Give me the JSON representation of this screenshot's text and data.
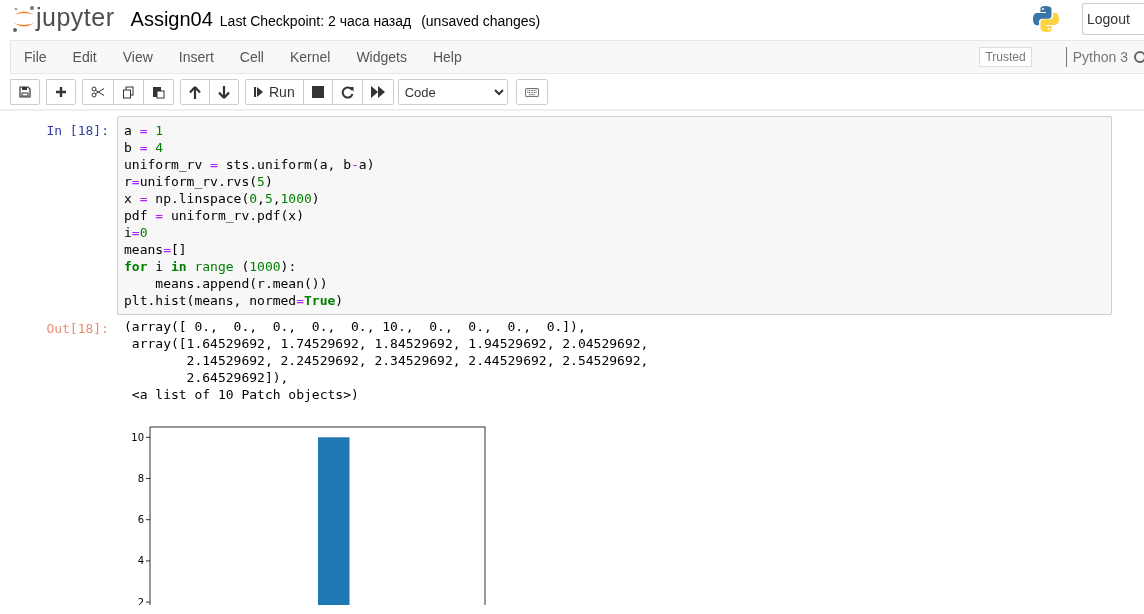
{
  "header": {
    "logo_text": "jupyter",
    "notebook_name": "Assign04",
    "checkpoint": "Last Checkpoint: 2 часа назад",
    "unsaved": "(unsaved changes)",
    "logout": "Logout"
  },
  "menu": [
    "File",
    "Edit",
    "View",
    "Insert",
    "Cell",
    "Kernel",
    "Widgets",
    "Help"
  ],
  "trusted": "Trusted",
  "kernel": "Python 3",
  "kernel_busy": false,
  "toolbar": {
    "groups": [
      [
        {
          "kind": "save"
        }
      ],
      [
        {
          "kind": "add"
        }
      ],
      [
        {
          "kind": "cut"
        },
        {
          "kind": "copy"
        },
        {
          "kind": "paste"
        }
      ],
      [
        {
          "kind": "up"
        },
        {
          "kind": "down"
        }
      ],
      [
        {
          "kind": "run",
          "label": "Run"
        },
        {
          "kind": "stop"
        },
        {
          "kind": "restart"
        },
        {
          "kind": "fast-forward"
        }
      ]
    ],
    "cell_type": "Code"
  },
  "cell": {
    "in_prompt": "In [18]:",
    "code": [
      [
        {
          "text": "a ",
          "kind": "plain"
        },
        {
          "text": "=",
          "kind": "operator"
        },
        {
          "text": " 1",
          "kind": "number"
        }
      ],
      [
        {
          "text": "b ",
          "kind": "plain"
        },
        {
          "text": "=",
          "kind": "operator"
        },
        {
          "text": " 4",
          "kind": "number"
        }
      ],
      [
        {
          "text": "uniform_rv ",
          "kind": "plain"
        },
        {
          "text": "=",
          "kind": "operator"
        },
        {
          "text": " sts.uniform(a, b",
          "kind": "plain"
        },
        {
          "text": "-",
          "kind": "operator"
        },
        {
          "text": "a)",
          "kind": "plain"
        }
      ],
      [
        {
          "text": "r",
          "kind": "plain"
        },
        {
          "text": "=",
          "kind": "operator"
        },
        {
          "text": "uniform_rv.rvs(",
          "kind": "plain"
        },
        {
          "text": "5",
          "kind": "number"
        },
        {
          "text": ")",
          "kind": "plain"
        }
      ],
      [
        {
          "text": "x ",
          "kind": "plain"
        },
        {
          "text": "=",
          "kind": "operator"
        },
        {
          "text": " np.linspace(",
          "kind": "plain"
        },
        {
          "text": "0",
          "kind": "number"
        },
        {
          "text": ",",
          "kind": "plain"
        },
        {
          "text": "5",
          "kind": "number"
        },
        {
          "text": ",",
          "kind": "plain"
        },
        {
          "text": "1000",
          "kind": "number"
        },
        {
          "text": ")",
          "kind": "plain"
        }
      ],
      [
        {
          "text": "pdf ",
          "kind": "plain"
        },
        {
          "text": "=",
          "kind": "operator"
        },
        {
          "text": " uniform_rv.pdf(x)",
          "kind": "plain"
        }
      ],
      [
        {
          "text": "i",
          "kind": "plain"
        },
        {
          "text": "=",
          "kind": "operator"
        },
        {
          "text": "0",
          "kind": "number"
        }
      ],
      [
        {
          "text": "means",
          "kind": "plain"
        },
        {
          "text": "=",
          "kind": "operator"
        },
        {
          "text": "[]",
          "kind": "plain"
        }
      ],
      [
        {
          "text": "for",
          "kind": "keyword"
        },
        {
          "text": " i ",
          "kind": "plain"
        },
        {
          "text": "in",
          "kind": "keyword"
        },
        {
          "text": " range",
          "kind": "builtin"
        },
        {
          "text": " (",
          "kind": "plain"
        },
        {
          "text": "1000",
          "kind": "number"
        },
        {
          "text": "):",
          "kind": "plain"
        }
      ],
      [
        {
          "text": "    means.append(r.mean())",
          "kind": "plain"
        }
      ],
      [
        {
          "text": "plt.hist(means, normed",
          "kind": "plain"
        },
        {
          "text": "=",
          "kind": "operator"
        },
        {
          "text": "True",
          "kind": "keyword"
        },
        {
          "text": ")",
          "kind": "plain"
        }
      ]
    ],
    "out_prompt": "Out[18]:",
    "output": [
      "(array([ 0.,  0.,  0.,  0.,  0., 10.,  0.,  0.,  0.,  0.]),",
      " array([1.64529692, 1.74529692, 1.84529692, 1.94529692, 2.04529692,",
      "        2.14529692, 2.24529692, 2.34529692, 2.44529692, 2.54529692,",
      "        2.64529692]),",
      " <a list of 10 Patch objects>)"
    ],
    "plot": {
      "y_tick_labels": [
        "10",
        "8",
        "6",
        "4",
        "2"
      ]
    }
  }
}
